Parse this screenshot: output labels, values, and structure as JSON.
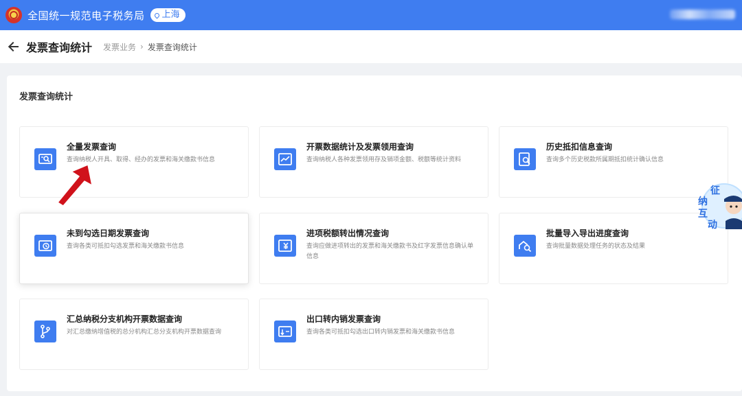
{
  "header": {
    "site_name": "全国统一规范电子税务局",
    "region": "上海"
  },
  "page": {
    "title": "发票查询统计",
    "breadcrumb": [
      "发票业务",
      "发票查询统计"
    ]
  },
  "section_title": "发票查询统计",
  "cards": [
    {
      "title": "全量发票查询",
      "desc": "查询纳税人开具、取得、经办的发票和海关缴款书信息",
      "icon": "invoice-search-icon"
    },
    {
      "title": "开票数据统计及发票领用查询",
      "desc": "查询纳税人各种发票领用存及销项金额、税额等统计资料",
      "icon": "chart-statistics-icon"
    },
    {
      "title": "历史抵扣信息查询",
      "desc": "查询多个历史税款所属期抵扣统计确认信息",
      "icon": "history-search-icon"
    },
    {
      "title": "未到勾选日期发票查询",
      "desc": "查询各类可抵扣勾选发票和海关缴款书信息",
      "icon": "clock-invoice-icon"
    },
    {
      "title": "进项税额转出情况查询",
      "desc": "查询应做进项转出的发票和海关缴款书及红字发票信息确认单信息",
      "icon": "yuan-transfer-icon"
    },
    {
      "title": "批量导入导出进度查询",
      "desc": "查询批量数据处理任务的状态及结果",
      "icon": "cloud-search-icon"
    },
    {
      "title": "汇总纳税分支机构开票数据查询",
      "desc": "对汇总缴纳增值税的总分机构汇总分支机构开票数据查询",
      "icon": "branch-icon"
    },
    {
      "title": "出口转内销发票查询",
      "desc": "查询各类可抵扣勾选出口转内销发票和海关缴款书信息",
      "icon": "export-invoice-icon"
    }
  ],
  "mascot": {
    "chars": [
      "征",
      "纳",
      "互",
      "动"
    ]
  },
  "colors": {
    "primary": "#3f7df0",
    "arrow": "#d0121b"
  }
}
